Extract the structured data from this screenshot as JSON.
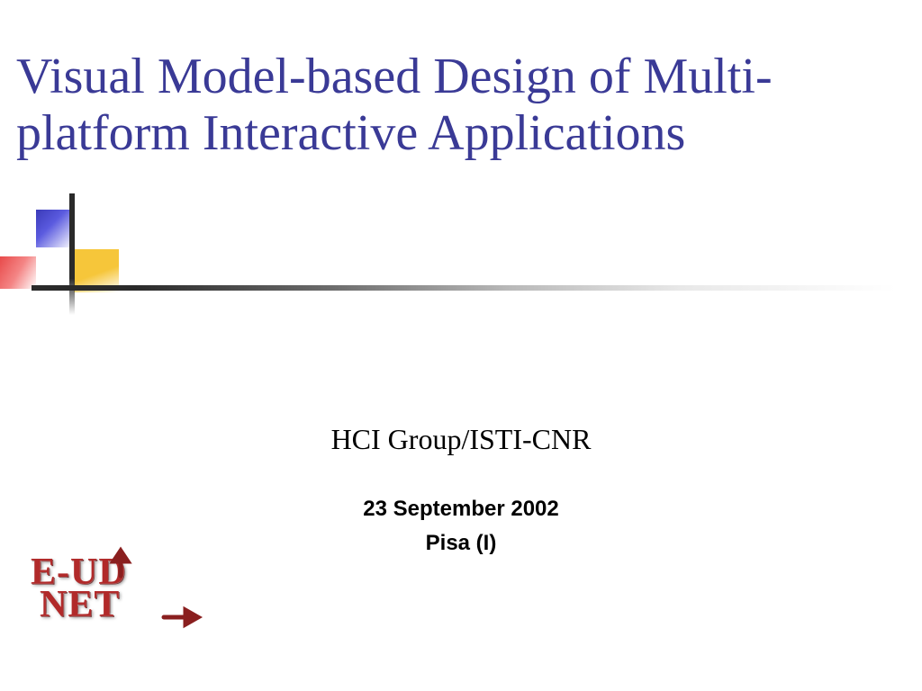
{
  "title": "Visual Model-based Design of Multi-platform Interactive Applications",
  "subtitle": "HCI Group/ISTI-CNR",
  "date": "23 September 2002",
  "place": "Pisa (I)",
  "logo": {
    "line1": "E-UD",
    "line2": "NET"
  },
  "colors": {
    "title": "#3a3a96",
    "logo": "#b12a2a"
  }
}
